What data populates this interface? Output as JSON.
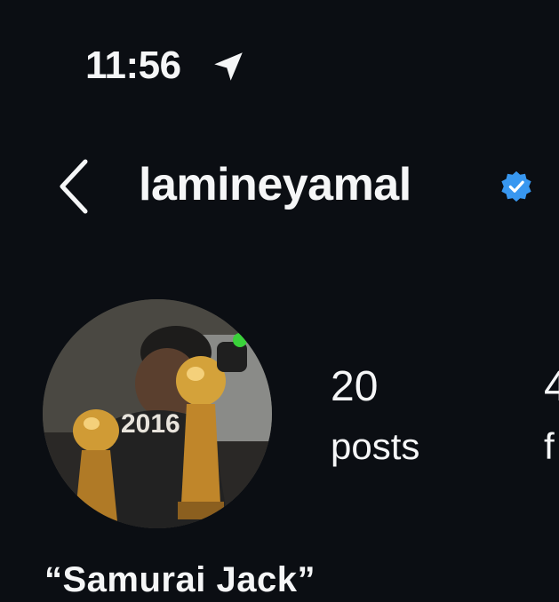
{
  "status_bar": {
    "time": "11:56",
    "location_icon": "location-arrow-icon"
  },
  "header": {
    "back_icon": "chevron-left-icon",
    "username": "lamineyamal",
    "verified_icon": "verified-badge-icon",
    "verified_color": "#3897f0"
  },
  "profile": {
    "avatar_icon": "profile-photo",
    "stats": {
      "posts_count": "20",
      "posts_label": "posts",
      "followers_count_partial": "4",
      "followers_label_partial": "f"
    },
    "bio_name": "“Samurai Jack”"
  },
  "colors": {
    "background": "#0b0e13",
    "text": "#f5f6f7",
    "accent": "#3897f0"
  }
}
